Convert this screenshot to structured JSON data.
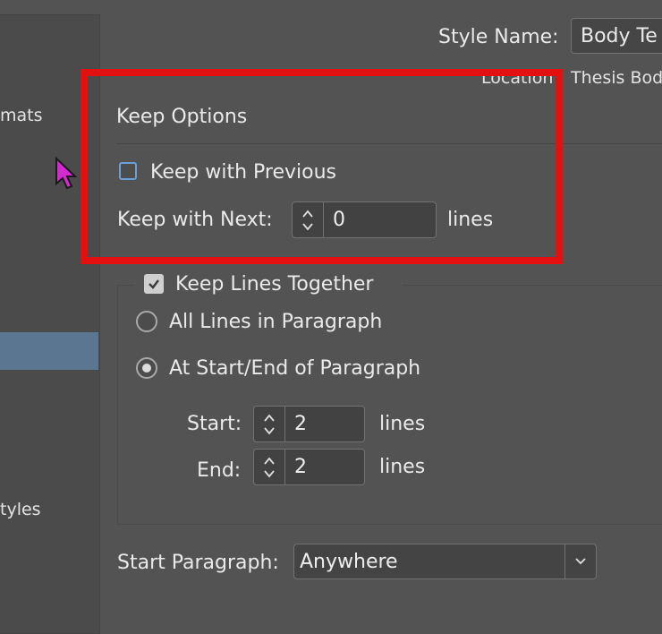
{
  "sidebar": {
    "item_formats": "mats",
    "item_styles": "tyles"
  },
  "header": {
    "style_name_label": "Style Name:",
    "style_name_value": "Body Te",
    "location_label": "Location",
    "location_value": "Thesis Bod"
  },
  "keep_options": {
    "title": "Keep Options",
    "keep_with_previous_label": "Keep with Previous",
    "keep_with_previous_checked": false,
    "keep_with_next_label": "Keep with Next:",
    "keep_with_next_value": "0",
    "keep_with_next_unit": "lines"
  },
  "keep_lines_together": {
    "label": "Keep Lines Together",
    "checked": true,
    "all_lines_label": "All Lines in Paragraph",
    "start_end_label": "At Start/End of Paragraph",
    "selected_option": "At Start/End of Paragraph",
    "start_label": "Start:",
    "start_value": "2",
    "start_unit": "lines",
    "end_label": "End:",
    "end_value": "2",
    "end_unit": "lines"
  },
  "start_paragraph": {
    "label": "Start Paragraph:",
    "value": "Anywhere"
  },
  "colors": {
    "background": "#535353",
    "highlight": "#e31010",
    "selection": "#5b7691",
    "cursor": "#d42bd0"
  }
}
